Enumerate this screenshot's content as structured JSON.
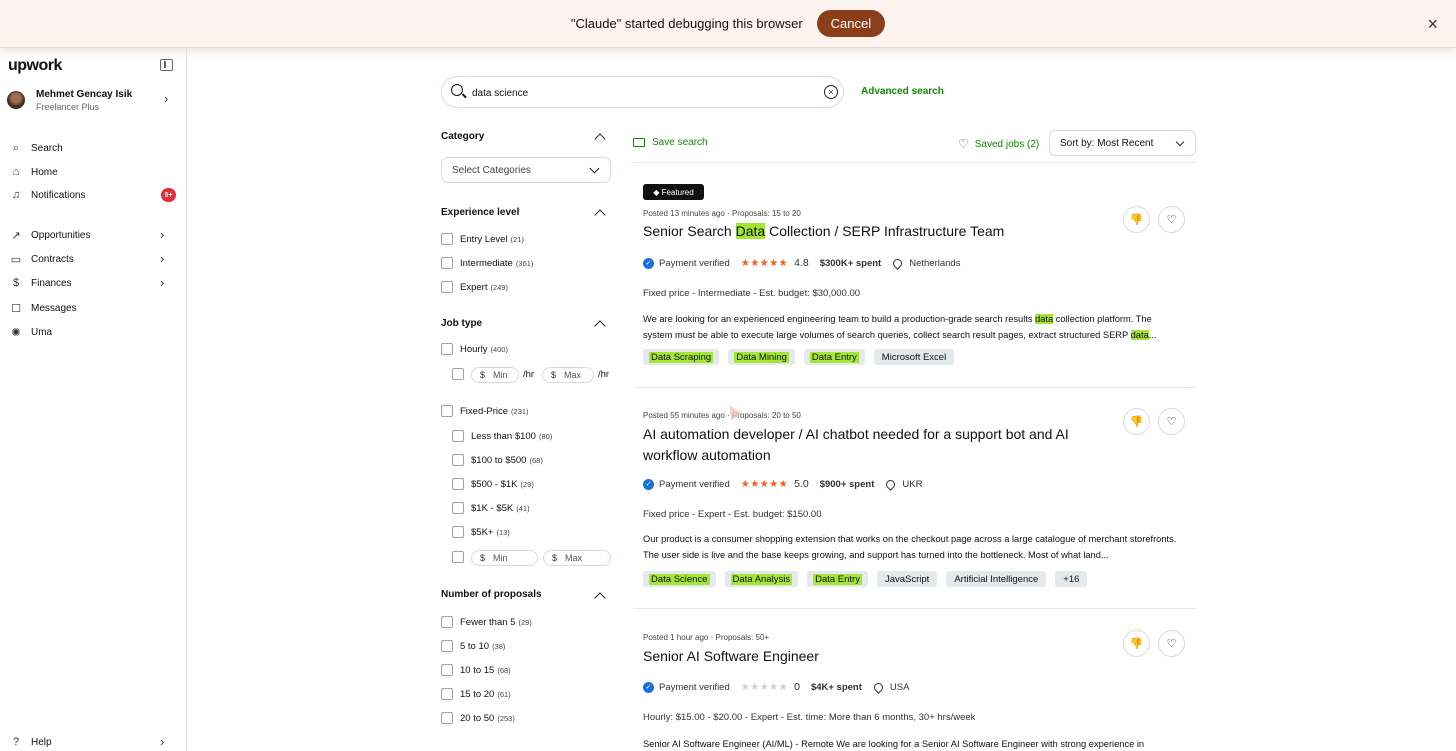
{
  "debug_bar": {
    "text": "\"Claude\" started debugging this browser",
    "cancel_label": "Cancel",
    "close": "×"
  },
  "sidebar": {
    "logo": "upwork",
    "profile": {
      "name": "Mehmet Gencay Isik",
      "plan": "Freelancer Plus"
    },
    "items": [
      {
        "label": "Search",
        "icon": "search-icon"
      },
      {
        "label": "Home",
        "icon": "home-icon"
      },
      {
        "label": "Notifications",
        "icon": "bell-icon",
        "badge": "9+"
      },
      {
        "label": "Opportunities",
        "icon": "trend-icon"
      },
      {
        "label": "Contracts",
        "icon": "contract-icon"
      },
      {
        "label": "Finances",
        "icon": "dollar-icon"
      },
      {
        "label": "Messages",
        "icon": "message-icon"
      },
      {
        "label": "Uma",
        "icon": "uma-icon"
      }
    ],
    "help_label": "Help"
  },
  "search": {
    "value": "data science",
    "advanced_label": "Advanced search"
  },
  "filters": {
    "category": {
      "title": "Category",
      "placeholder": "Select Categories"
    },
    "experience": {
      "title": "Experience level",
      "options": [
        {
          "label": "Entry Level",
          "count": "(21)"
        },
        {
          "label": "Intermediate",
          "count": "(361)"
        },
        {
          "label": "Expert",
          "count": "(249)"
        }
      ]
    },
    "job_type": {
      "title": "Job type",
      "hourly": {
        "label": "Hourly",
        "count": "(400)",
        "min": "Min",
        "max": "Max",
        "unit": "/hr",
        "currency": "$"
      },
      "fixed": {
        "label": "Fixed-Price",
        "count": "(231)",
        "options": [
          {
            "label": "Less than $100",
            "count": "(80)"
          },
          {
            "label": "$100 to $500",
            "count": "(68)"
          },
          {
            "label": "$500 - $1K",
            "count": "(29)"
          },
          {
            "label": "$1K - $5K",
            "count": "(41)"
          },
          {
            "label": "$5K+",
            "count": "(13)"
          }
        ],
        "min": "Min",
        "max": "Max"
      }
    },
    "proposals": {
      "title": "Number of proposals",
      "options": [
        {
          "label": "Fewer than 5",
          "count": "(29)"
        },
        {
          "label": "5 to 10",
          "count": "(38)"
        },
        {
          "label": "10 to 15",
          "count": "(68)"
        },
        {
          "label": "15 to 20",
          "count": "(61)"
        },
        {
          "label": "20 to 50",
          "count": "(253)"
        }
      ]
    }
  },
  "results_header": {
    "save_search": "Save search",
    "saved_jobs": "Saved jobs (2)",
    "sort": "Sort by: Most Recent"
  },
  "jobs": [
    {
      "featured": "Featured",
      "meta": "Posted 13 minutes ago  ·  Proposals: 15 to 20",
      "title_pre": "Senior Search ",
      "title_hl": "Data",
      "title_post": " Collection / SERP Infrastructure Team",
      "payment": "Payment verified",
      "rating": "4.8",
      "spent": "$300K+ spent",
      "location": "Netherlands",
      "budget": "Fixed price - Intermediate - Est. budget: $30,000.00",
      "desc_1a": "We are looking for an experienced engineering team to build a production-grade search results ",
      "desc_1hl": "data",
      "desc_1b": " collection platform. The",
      "desc_2a": "system must be able to execute large volumes of search queries, collect search result pages, extract structured SERP ",
      "desc_2hl": "data",
      "desc_2b": "...",
      "tags": [
        "Data Scraping",
        "Data Mining",
        "Data Entry",
        "Microsoft Excel"
      ]
    },
    {
      "meta": "Posted 55 minutes ago  ·  Proposals: 20 to 50",
      "title": "AI automation developer / AI chatbot needed for a support bot and AI workflow automation",
      "payment": "Payment verified",
      "rating": "5.0",
      "spent": "$900+ spent",
      "location": "UKR",
      "budget": "Fixed price - Expert - Est. budget: $150.00",
      "desc": "Our product is a consumer shopping extension that works on the checkout page across a large catalogue of merchant storefronts. The user side is live and the base keeps growing, and support has turned into the bottleneck. Most of what land...",
      "tags": [
        "Data Science",
        "Data Analysis",
        "Data Entry",
        "JavaScript",
        "Artificial Intelligence",
        "+16"
      ]
    },
    {
      "meta": "Posted 1 hour ago  ·  Proposals: 50+",
      "title": "Senior AI Software Engineer",
      "payment": "Payment verified",
      "rating": "0",
      "spent": "$4K+ spent",
      "location": "USA",
      "budget": "Hourly: $15.00 - $20.00 - Expert - Est. time: More than 6 months, 30+ hrs/week",
      "desc": "Senior AI Software Engineer (AI/ML) - Remote We are looking for a Senior AI Software Engineer with strong experience in"
    }
  ],
  "colors": {
    "brand_green": "#108a00",
    "highlight": "#a3e635",
    "star": "#ff5a1f",
    "badge": "#e0313b"
  }
}
